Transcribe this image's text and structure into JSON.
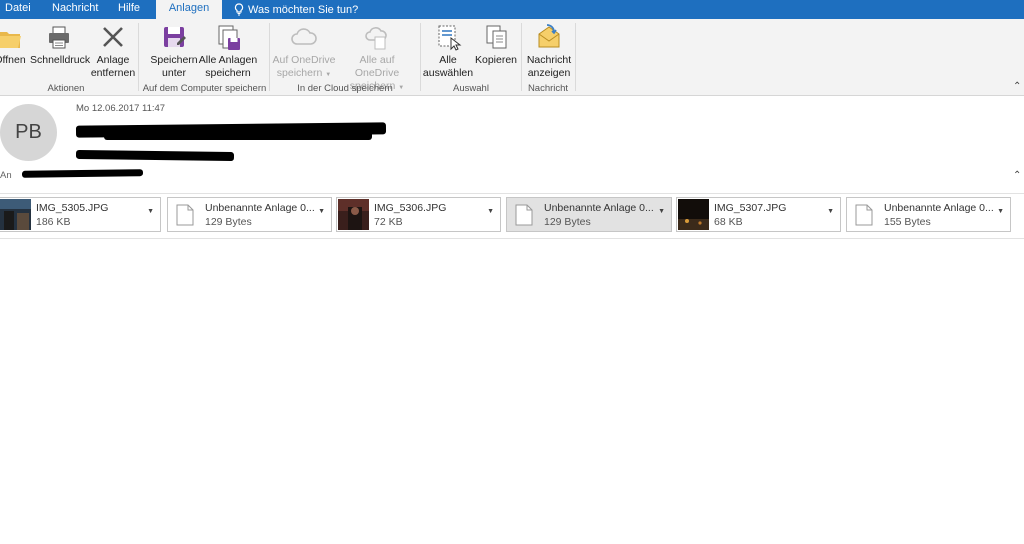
{
  "tabs": [
    {
      "label": "Datei"
    },
    {
      "label": "Nachricht"
    },
    {
      "label": "Hilfe"
    },
    {
      "label": "Anlagen"
    }
  ],
  "tell_me": "Was möchten Sie tun?",
  "ribbon": {
    "groups": {
      "aktionen": "Aktionen",
      "computer": "Auf dem Computer speichern",
      "cloud": "In der Cloud speichern",
      "auswahl": "Auswahl",
      "nachricht": "Nachricht"
    },
    "buttons": {
      "oeffnen": "Öffnen",
      "schnelldruck": "Schnelldruck",
      "anlage_entfernen_1": "Anlage",
      "anlage_entfernen_2": "entfernen",
      "speichern_unter_1": "Speichern",
      "speichern_unter_2": "unter",
      "alle_anlagen_1": "Alle Anlagen",
      "alle_anlagen_2": "speichern",
      "onedrive_1": "Auf OneDrive",
      "onedrive_2": "speichern",
      "alle_onedrive_1": "Alle auf OneDrive",
      "alle_onedrive_2": "speichern",
      "alle_auswaehlen_1": "Alle",
      "alle_auswaehlen_2": "auswählen",
      "kopieren": "Kopieren",
      "nachricht_anzeigen_1": "Nachricht",
      "nachricht_anzeigen_2": "anzeigen"
    }
  },
  "header": {
    "avatar_initials": "PB",
    "date": "Mo 12.06.2017 11:47",
    "to_label": "An"
  },
  "attachments": [
    {
      "name": "IMG_5305.JPG",
      "size": "186 KB",
      "type": "image"
    },
    {
      "name": "Unbenannte Anlage 0...",
      "size": "129 Bytes",
      "type": "file"
    },
    {
      "name": "IMG_5306.JPG",
      "size": "72 KB",
      "type": "image"
    },
    {
      "name": "Unbenannte Anlage 0...",
      "size": "129 Bytes",
      "type": "file",
      "selected": true
    },
    {
      "name": "IMG_5307.JPG",
      "size": "68 KB",
      "type": "image"
    },
    {
      "name": "Unbenannte Anlage 0...",
      "size": "155 Bytes",
      "type": "file"
    }
  ],
  "colors": {
    "accent": "#1e6fbf",
    "ribbon_bg": "#f3f3f3",
    "selected_attachment": "#e2e2e2"
  }
}
